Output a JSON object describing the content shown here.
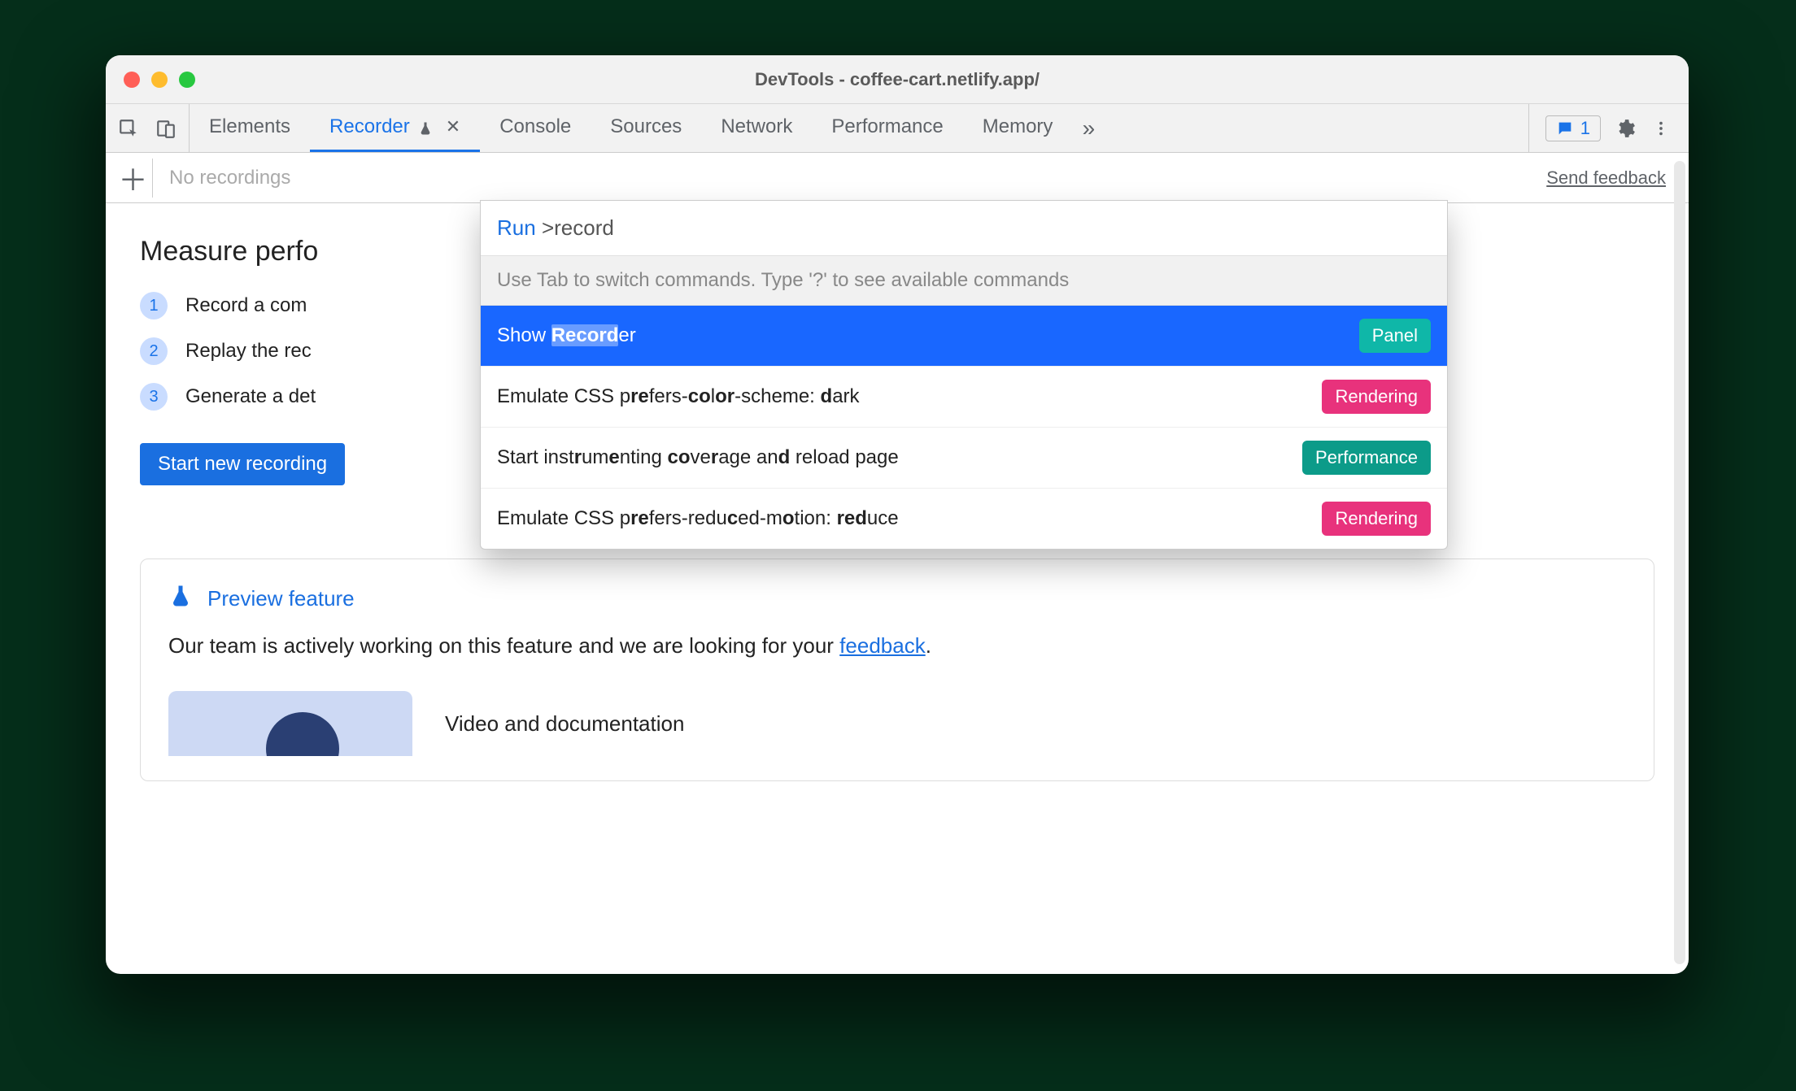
{
  "window": {
    "title": "DevTools - coffee-cart.netlify.app/"
  },
  "tabs": {
    "elements": "Elements",
    "recorder": "Recorder",
    "console": "Console",
    "sources": "Sources",
    "network": "Network",
    "performance": "Performance",
    "memory": "Memory"
  },
  "issues_count": "1",
  "toolbar": {
    "no_recordings": "No recordings",
    "send_feedback": "Send feedback"
  },
  "main": {
    "heading": "Measure perfo",
    "step1": "Record a com",
    "step2": "Replay the rec",
    "step3": "Generate a det",
    "start_button": "Start new recording"
  },
  "preview": {
    "label": "Preview feature",
    "text_before": "Our team is actively working on this feature and we are looking for your ",
    "link": "feedback",
    "text_after": ".",
    "video_label": "Video and documentation"
  },
  "cmd": {
    "prefix": "Run",
    "caret": ">",
    "query": "record",
    "hint": "Use Tab to switch commands. Type '?' to see available commands",
    "rows": [
      {
        "html": "Show <span class='hl'>Record</span>er",
        "badge": "Panel",
        "badge_class": "panel",
        "selected": true
      },
      {
        "html": "Emulate CSS p<u class='match'>re</u>fers-<u class='match'>c</u><u class='match'>o</u>l<u class='match'>or</u>-scheme: <u class='match'>d</u>ark",
        "badge": "Rendering",
        "badge_class": "render"
      },
      {
        "html": "Start inst<u class='match'>r</u>um<u class='match'>e</u>nting <u class='match'>co</u>ve<u class='match'>r</u>age an<u class='match'>d</u> reload page",
        "badge": "Performance",
        "badge_class": "perf"
      },
      {
        "html": "Emulate CSS p<u class='match'>re</u>fers-redu<u class='match'>c</u>ed-m<u class='match'>o</u>tion: <u class='match'>re</u><u class='match'>d</u>uce",
        "badge": "Rendering",
        "badge_class": "render"
      }
    ]
  }
}
